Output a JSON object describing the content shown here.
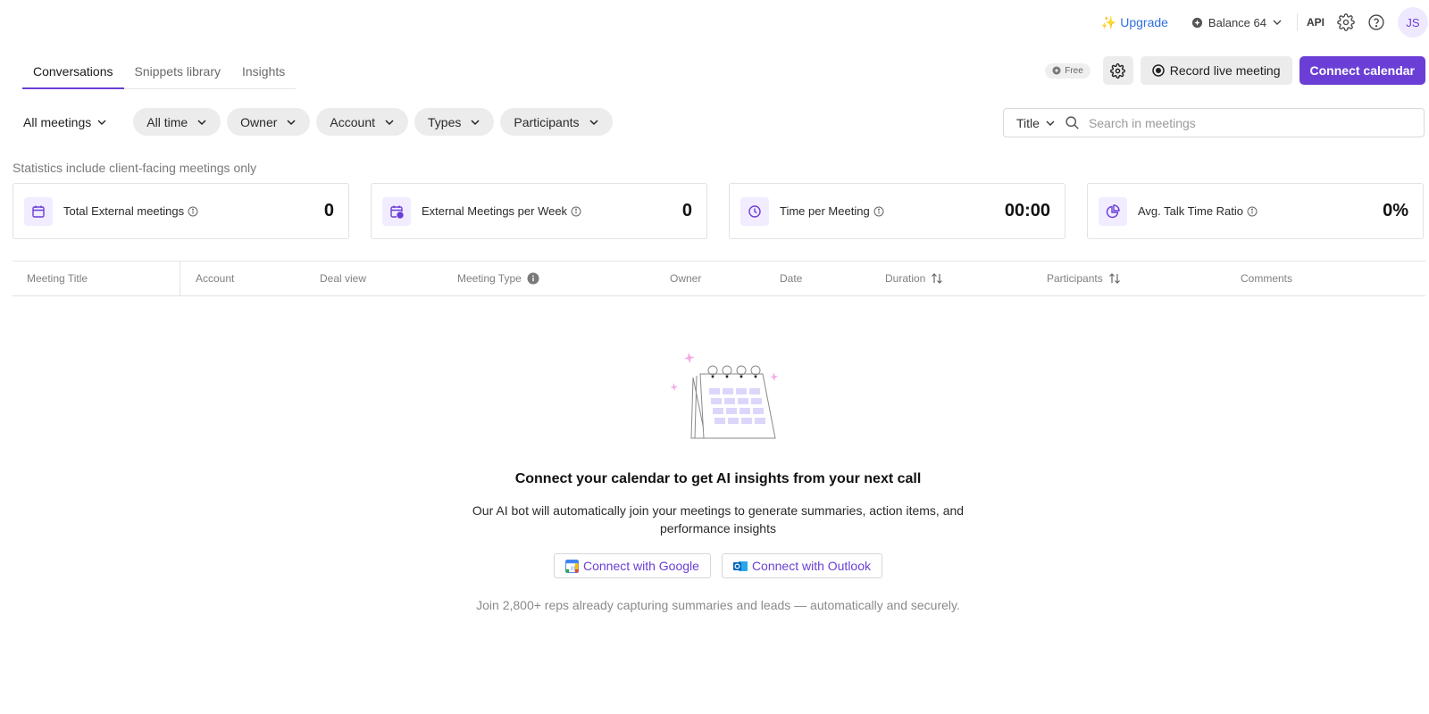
{
  "topbar": {
    "upgrade_label": "Upgrade",
    "balance_label": "Balance 64",
    "api_label": "API",
    "avatar_initials": "JS"
  },
  "tabs": [
    {
      "label": "Conversations",
      "active": true
    },
    {
      "label": "Snippets library",
      "active": false
    },
    {
      "label": "Insights",
      "active": false
    }
  ],
  "actions": {
    "free_label": "Free",
    "record_label": "Record live meeting",
    "connect_label": "Connect calendar"
  },
  "filters": {
    "view_label": "All meetings",
    "pills": [
      "All time",
      "Owner",
      "Account",
      "Types",
      "Participants"
    ]
  },
  "search": {
    "field_label": "Title",
    "placeholder": "Search in meetings"
  },
  "stats": {
    "note": "Statistics include client-facing meetings only",
    "cards": [
      {
        "icon": "calendar-icon",
        "label": "Total External meetings",
        "value": "0"
      },
      {
        "icon": "calendar-clock-icon",
        "label": "External Meetings per Week",
        "value": "0"
      },
      {
        "icon": "clock-icon",
        "label": "Time per Meeting",
        "value": "00:00"
      },
      {
        "icon": "pie-chart-icon",
        "label": "Avg. Talk Time Ratio",
        "value": "0%"
      }
    ]
  },
  "table": {
    "columns": [
      "Meeting Title",
      "Account",
      "Deal view",
      "Meeting Type",
      "Owner",
      "Date",
      "Duration",
      "Participants",
      "Comments"
    ]
  },
  "empty": {
    "title": "Connect your calendar to get AI insights from your next call",
    "description": "Our AI bot will automatically join your meetings to generate summaries, action items, and performance insights",
    "google_label": "Connect with Google",
    "outlook_label": "Connect with Outlook",
    "join_text": "Join 2,800+ reps already capturing summaries and leads — automatically and securely."
  },
  "colors": {
    "accent": "#6b3fd6",
    "upgrade": "#2f6fe0"
  }
}
